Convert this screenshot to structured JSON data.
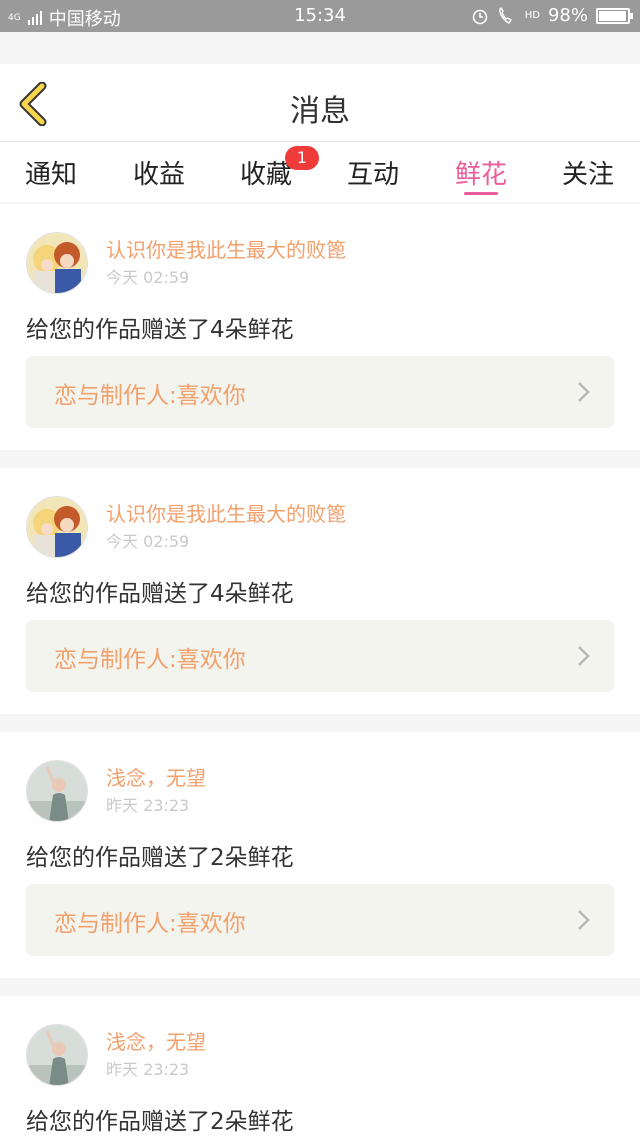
{
  "status_bar": {
    "network_label": "4G",
    "carrier": "中国移动",
    "time": "15:34",
    "hd_label": "HD",
    "battery": "98%",
    "battery_level": 0.98
  },
  "header": {
    "title": "消息"
  },
  "tabs": [
    {
      "label": "通知"
    },
    {
      "label": "收益"
    },
    {
      "label": "收藏",
      "badge": "1"
    },
    {
      "label": "互动"
    },
    {
      "label": "鲜花",
      "active": true
    },
    {
      "label": "关注"
    }
  ],
  "colors": {
    "accent": "#ec5b9a",
    "name_orange": "#f2a06c",
    "badge_red": "#f03b3b"
  },
  "messages": [
    {
      "user": "认识你是我此生最大的败篦",
      "time": "今天 02:59",
      "text": "给您的作品赠送了4朵鲜花",
      "work": "恋与制作人:喜欢你",
      "avatar": "anime-couple-avatar"
    },
    {
      "user": "认识你是我此生最大的败篦",
      "time": "今天 02:59",
      "text": "给您的作品赠送了4朵鲜花",
      "work": "恋与制作人:喜欢你",
      "avatar": "anime-couple-avatar"
    },
    {
      "user": "浅念，无望",
      "time": "昨天 23:23",
      "text": "给您的作品赠送了2朵鲜花",
      "work": "恋与制作人:喜欢你",
      "avatar": "girl-photo-avatar"
    },
    {
      "user": "浅念，无望",
      "time": "昨天 23:23",
      "text": "给您的作品赠送了2朵鲜花",
      "work": "",
      "avatar": "girl-photo-avatar"
    }
  ]
}
